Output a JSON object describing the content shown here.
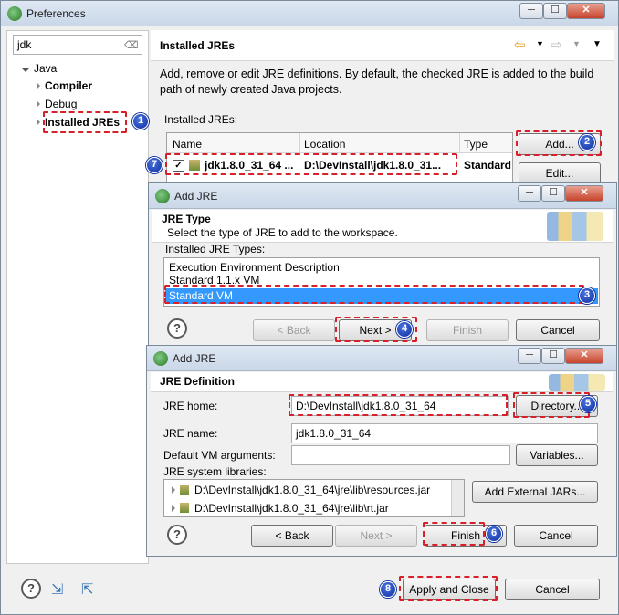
{
  "preferences": {
    "title": "Preferences",
    "filter_value": "jdk",
    "tree": {
      "java": "Java",
      "compiler": "Compiler",
      "debug": "Debug",
      "installed_jres": "Installed JREs"
    },
    "page_title": "Installed JREs",
    "description": "Add, remove or edit JRE definitions. By default, the checked JRE is added to the build path of newly created Java projects.",
    "list_label": "Installed JREs:",
    "columns": [
      "Name",
      "Location",
      "Type"
    ],
    "row": {
      "name": "jdk1.8.0_31_64 ...",
      "location": "D:\\DevInstall\\jdk1.8.0_31...",
      "type": "Standard"
    },
    "add_label": "Add...",
    "edit_label": "Edit...",
    "apply_close_label": "Apply and Close",
    "cancel_label": "Cancel"
  },
  "add_jre_type": {
    "title": "Add JRE",
    "heading": "JRE Type",
    "subtitle": "Select the type of JRE to add to the workspace.",
    "list_label": "Installed JRE Types:",
    "types": [
      "Execution Environment Description",
      "Standard 1.1.x VM",
      "Standard VM"
    ],
    "back_label": "< Back",
    "next_label": "Next >",
    "finish_label": "Finish",
    "cancel_label": "Cancel"
  },
  "add_jre_def": {
    "title": "Add JRE",
    "heading": "JRE Definition",
    "jre_home_label": "JRE home:",
    "jre_home_value": "D:\\DevInstall\\jdk1.8.0_31_64",
    "directory_label": "Directory...",
    "jre_name_label": "JRE name:",
    "jre_name_value": "jdk1.8.0_31_64",
    "vm_args_label": "Default VM arguments:",
    "variables_label": "Variables...",
    "libs_label": "JRE system libraries:",
    "libs": [
      "D:\\DevInstall\\jdk1.8.0_31_64\\jre\\lib\\resources.jar",
      "D:\\DevInstall\\jdk1.8.0_31_64\\jre\\lib\\rt.jar"
    ],
    "add_external_label": "Add External JARs...",
    "back_label": "< Back",
    "next_label": "Next >",
    "finish_label": "Finish",
    "cancel_label": "Cancel"
  },
  "badges": [
    "1",
    "2",
    "3",
    "4",
    "5",
    "6",
    "7",
    "8"
  ],
  "colors": {
    "annotation_red": "#d8202a",
    "badge_blue": "#1b3fb8",
    "selection_blue": "#3399ff"
  }
}
